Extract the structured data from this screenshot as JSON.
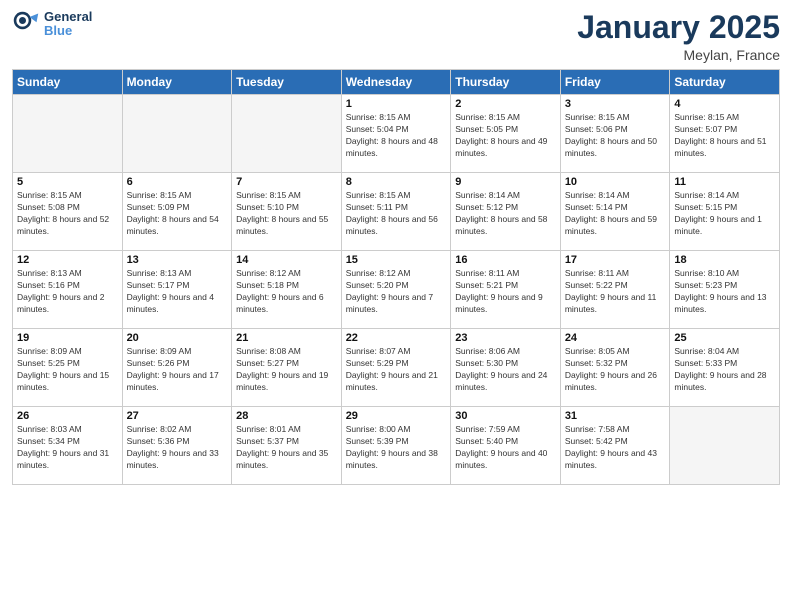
{
  "header": {
    "logo_general": "General",
    "logo_blue": "Blue",
    "month_title": "January 2025",
    "location": "Meylan, France"
  },
  "weekdays": [
    "Sunday",
    "Monday",
    "Tuesday",
    "Wednesday",
    "Thursday",
    "Friday",
    "Saturday"
  ],
  "weeks": [
    [
      {
        "day": "",
        "empty": true
      },
      {
        "day": "",
        "empty": true
      },
      {
        "day": "",
        "empty": true
      },
      {
        "day": "1",
        "sunrise": "8:15 AM",
        "sunset": "5:04 PM",
        "daylight": "8 hours and 48 minutes."
      },
      {
        "day": "2",
        "sunrise": "8:15 AM",
        "sunset": "5:05 PM",
        "daylight": "8 hours and 49 minutes."
      },
      {
        "day": "3",
        "sunrise": "8:15 AM",
        "sunset": "5:06 PM",
        "daylight": "8 hours and 50 minutes."
      },
      {
        "day": "4",
        "sunrise": "8:15 AM",
        "sunset": "5:07 PM",
        "daylight": "8 hours and 51 minutes."
      }
    ],
    [
      {
        "day": "5",
        "sunrise": "8:15 AM",
        "sunset": "5:08 PM",
        "daylight": "8 hours and 52 minutes."
      },
      {
        "day": "6",
        "sunrise": "8:15 AM",
        "sunset": "5:09 PM",
        "daylight": "8 hours and 54 minutes."
      },
      {
        "day": "7",
        "sunrise": "8:15 AM",
        "sunset": "5:10 PM",
        "daylight": "8 hours and 55 minutes."
      },
      {
        "day": "8",
        "sunrise": "8:15 AM",
        "sunset": "5:11 PM",
        "daylight": "8 hours and 56 minutes."
      },
      {
        "day": "9",
        "sunrise": "8:14 AM",
        "sunset": "5:12 PM",
        "daylight": "8 hours and 58 minutes."
      },
      {
        "day": "10",
        "sunrise": "8:14 AM",
        "sunset": "5:14 PM",
        "daylight": "8 hours and 59 minutes."
      },
      {
        "day": "11",
        "sunrise": "8:14 AM",
        "sunset": "5:15 PM",
        "daylight": "9 hours and 1 minute."
      }
    ],
    [
      {
        "day": "12",
        "sunrise": "8:13 AM",
        "sunset": "5:16 PM",
        "daylight": "9 hours and 2 minutes."
      },
      {
        "day": "13",
        "sunrise": "8:13 AM",
        "sunset": "5:17 PM",
        "daylight": "9 hours and 4 minutes."
      },
      {
        "day": "14",
        "sunrise": "8:12 AM",
        "sunset": "5:18 PM",
        "daylight": "9 hours and 6 minutes."
      },
      {
        "day": "15",
        "sunrise": "8:12 AM",
        "sunset": "5:20 PM",
        "daylight": "9 hours and 7 minutes."
      },
      {
        "day": "16",
        "sunrise": "8:11 AM",
        "sunset": "5:21 PM",
        "daylight": "9 hours and 9 minutes."
      },
      {
        "day": "17",
        "sunrise": "8:11 AM",
        "sunset": "5:22 PM",
        "daylight": "9 hours and 11 minutes."
      },
      {
        "day": "18",
        "sunrise": "8:10 AM",
        "sunset": "5:23 PM",
        "daylight": "9 hours and 13 minutes."
      }
    ],
    [
      {
        "day": "19",
        "sunrise": "8:09 AM",
        "sunset": "5:25 PM",
        "daylight": "9 hours and 15 minutes."
      },
      {
        "day": "20",
        "sunrise": "8:09 AM",
        "sunset": "5:26 PM",
        "daylight": "9 hours and 17 minutes."
      },
      {
        "day": "21",
        "sunrise": "8:08 AM",
        "sunset": "5:27 PM",
        "daylight": "9 hours and 19 minutes."
      },
      {
        "day": "22",
        "sunrise": "8:07 AM",
        "sunset": "5:29 PM",
        "daylight": "9 hours and 21 minutes."
      },
      {
        "day": "23",
        "sunrise": "8:06 AM",
        "sunset": "5:30 PM",
        "daylight": "9 hours and 24 minutes."
      },
      {
        "day": "24",
        "sunrise": "8:05 AM",
        "sunset": "5:32 PM",
        "daylight": "9 hours and 26 minutes."
      },
      {
        "day": "25",
        "sunrise": "8:04 AM",
        "sunset": "5:33 PM",
        "daylight": "9 hours and 28 minutes."
      }
    ],
    [
      {
        "day": "26",
        "sunrise": "8:03 AM",
        "sunset": "5:34 PM",
        "daylight": "9 hours and 31 minutes."
      },
      {
        "day": "27",
        "sunrise": "8:02 AM",
        "sunset": "5:36 PM",
        "daylight": "9 hours and 33 minutes."
      },
      {
        "day": "28",
        "sunrise": "8:01 AM",
        "sunset": "5:37 PM",
        "daylight": "9 hours and 35 minutes."
      },
      {
        "day": "29",
        "sunrise": "8:00 AM",
        "sunset": "5:39 PM",
        "daylight": "9 hours and 38 minutes."
      },
      {
        "day": "30",
        "sunrise": "7:59 AM",
        "sunset": "5:40 PM",
        "daylight": "9 hours and 40 minutes."
      },
      {
        "day": "31",
        "sunrise": "7:58 AM",
        "sunset": "5:42 PM",
        "daylight": "9 hours and 43 minutes."
      },
      {
        "day": "",
        "empty": true
      }
    ]
  ]
}
